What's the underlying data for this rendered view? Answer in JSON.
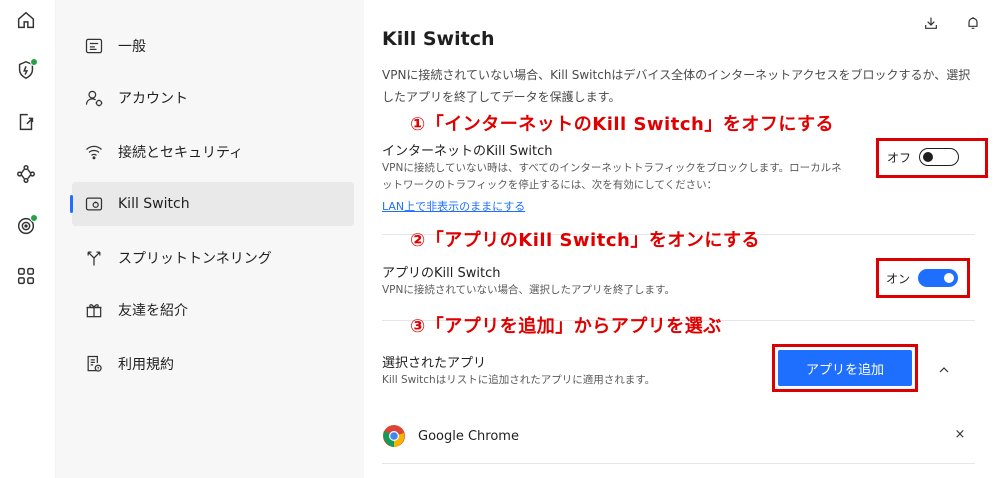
{
  "sidebar": {
    "items": [
      {
        "label": "一般",
        "icon": "general-settings-icon"
      },
      {
        "label": "アカウント",
        "icon": "account-icon"
      },
      {
        "label": "接続とセキュリティ",
        "icon": "wifi-icon"
      },
      {
        "label": "Kill Switch",
        "icon": "kill-switch-icon",
        "active": true
      },
      {
        "label": "スプリットトンネリング",
        "icon": "split-tunnel-icon"
      },
      {
        "label": "友達を紹介",
        "icon": "gift-icon"
      },
      {
        "label": "利用規約",
        "icon": "terms-icon"
      }
    ]
  },
  "rail": {
    "icons": [
      "home-icon",
      "shield-bolt-icon",
      "export-icon",
      "mesh-icon",
      "target-icon",
      "apps-grid-icon"
    ]
  },
  "header": {
    "title": "Kill Switch",
    "description": "VPNに接続されていない場合、Kill Switchはデバイス全体のインターネットアクセスをブロックするか、選択したアプリを終了してデータを保護します。"
  },
  "annotations": {
    "step1": "①「インターネットのKill Switch」をオフにする",
    "step2": "②「アプリのKill Switch」をオンにする",
    "step3": "③「アプリを追加」からアプリを選ぶ"
  },
  "internet_kill_switch": {
    "title": "インターネットのKill Switch",
    "description": "VPNに接続していない時は、すべてのインターネットトラフィックをブロックします。ローカルネットワークのトラフィックを停止するには、次を有効にしてください：",
    "link": "LAN上で非表示のままにする",
    "toggle_label": "オフ",
    "enabled": false
  },
  "app_kill_switch": {
    "title": "アプリのKill Switch",
    "description": "VPNに接続されていない場合、選択したアプリを終了します。",
    "toggle_label": "オン",
    "enabled": true
  },
  "selected_apps": {
    "title": "選択されたアプリ",
    "description": "Kill Switchはリストに追加されたアプリに適用されます。",
    "add_button": "アプリを追加",
    "apps": [
      {
        "name": "Google Chrome",
        "icon": "chrome-icon"
      }
    ],
    "remove_label": "×"
  },
  "colors": {
    "accent": "#1f6fff",
    "annotation": "#e00000",
    "status_green": "#22a34a"
  }
}
